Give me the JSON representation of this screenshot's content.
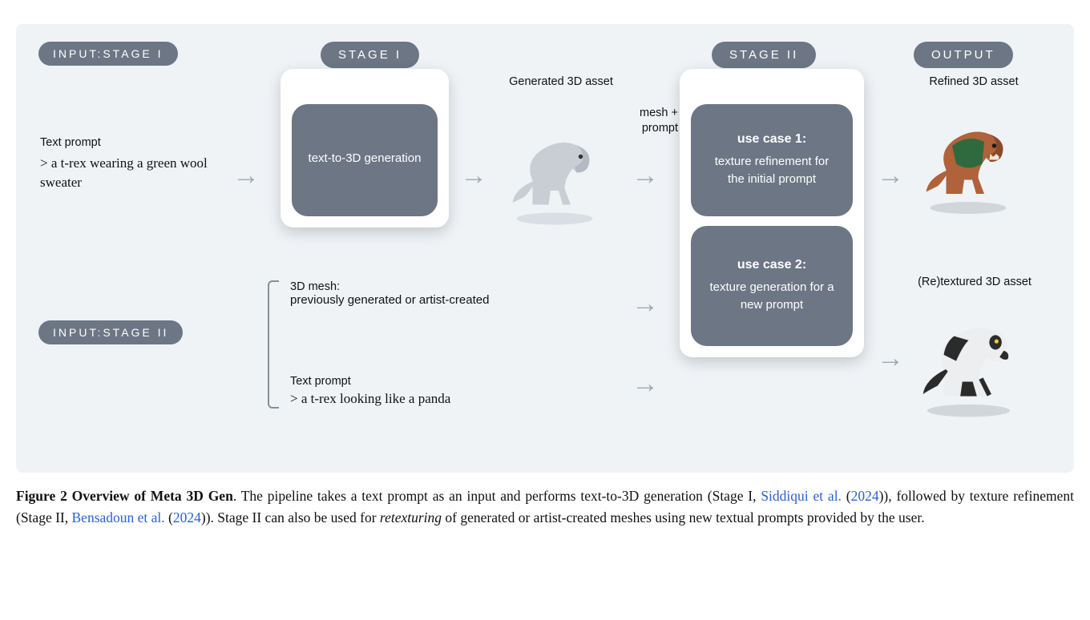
{
  "header": {
    "input_stage_1_label": "INPUT:STAGE I",
    "stage_1_label": "STAGE I",
    "stage_2_label": "STAGE II",
    "output_label": "OUTPUT",
    "input_stage_2_label": "INPUT:STAGE II"
  },
  "stage1": {
    "block_title": "text-to-3D generation"
  },
  "input1": {
    "label": "Text prompt",
    "prompt": "> a t-rex wearing a green wool sweater"
  },
  "mid": {
    "top_label": "Generated 3D asset",
    "mesh_label_line1": "mesh +",
    "mesh_label_line2": "prompt"
  },
  "stage2": {
    "use1_title": "use case 1:",
    "use1_body": "texture refinement for the initial prompt",
    "use2_title": "use case 2:",
    "use2_body": "texture generation for a new prompt"
  },
  "output": {
    "top_label": "Refined 3D asset",
    "bottom_label": "(Re)textured 3D asset"
  },
  "input2": {
    "mesh_label": "3D mesh:",
    "mesh_sub": "previously generated or artist-created",
    "prompt_label": "Text prompt",
    "prompt": "> a t-rex looking like a panda"
  },
  "caption": {
    "fig_label": "Figure 2",
    "fig_title": "Overview of Meta 3D Gen",
    "part1": ". The pipeline takes a text prompt as an input and performs text-to-3D generation (Stage I, ",
    "ref1_text": "Siddiqui et al.",
    "ref1_year": "2024",
    "part2": "), followed by texture refinement (Stage II, ",
    "ref2_text": "Bensadoun et al.",
    "ref2_year": "2024",
    "part3": "). Stage II can also be used for ",
    "ital": "retexturing",
    "part4": " of generated or artist-created meshes using new textual prompts provided by the user."
  }
}
